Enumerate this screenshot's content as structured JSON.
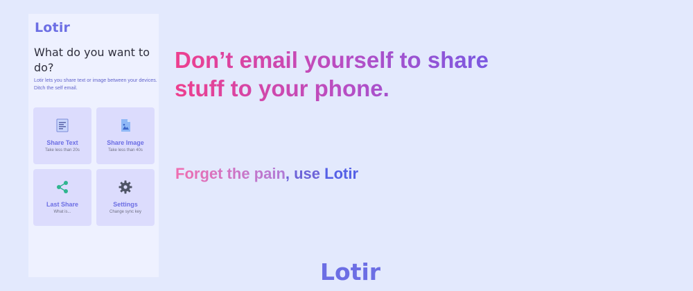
{
  "app": {
    "logo": "Lotir"
  },
  "phone": {
    "heading": "What do you want to do?",
    "description": "Lotir lets you share text or image between your devices. Ditch the self email.",
    "cards": [
      {
        "title": "Share Text",
        "subtitle": "Take less than 20s",
        "icon": "document-text-icon"
      },
      {
        "title": "Share Image",
        "subtitle": "Take less than 40s",
        "icon": "image-file-icon"
      },
      {
        "title": "Last Share",
        "subtitle": "What is...",
        "icon": "share-icon"
      },
      {
        "title": "Settings",
        "subtitle": "Change sync key",
        "icon": "gear-icon"
      }
    ]
  },
  "hero": {
    "headline": "Don’t email yourself to share stuff to your phone.",
    "tagline_pre": "Forget the pain",
    "tagline_mid": ", use ",
    "tagline_brand": "Lotir"
  },
  "footer": {
    "logo": "Lotir"
  },
  "colors": {
    "background": "#e3e9fd",
    "brand": "#6c6ee4",
    "card": "#dcdcfd",
    "gradient_start": "#ee3f8e",
    "gradient_end": "#5a5ef0"
  }
}
